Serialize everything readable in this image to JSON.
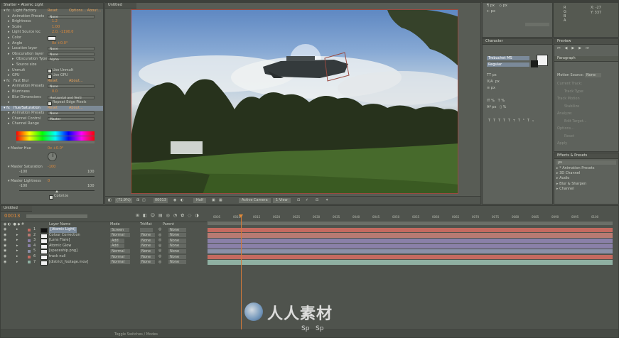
{
  "effect_controls": {
    "tab_title": "Shatter • Atomic Light",
    "rows": [
      {
        "label": "Light Factory",
        "value": "Reset",
        "extra": "Options...  About...",
        "indent": 0,
        "kind": "header"
      },
      {
        "label": "Animation Presets",
        "value": "None",
        "indent": 1,
        "kind": "dropdown"
      },
      {
        "label": "Brightness",
        "value": "1.2",
        "indent": 1,
        "kind": "value"
      },
      {
        "label": "Scale",
        "value": "1.00",
        "indent": 1,
        "kind": "value"
      },
      {
        "label": "Light Source loc",
        "value": "2.0, -1190.0",
        "indent": 1,
        "kind": "value"
      },
      {
        "label": "Color",
        "value": "",
        "indent": 1,
        "kind": "color"
      },
      {
        "label": "Angle",
        "value": "0x +0.0°",
        "indent": 1,
        "kind": "value"
      },
      {
        "label": "Location layer",
        "value": "None",
        "indent": 1,
        "kind": "dropdown"
      },
      {
        "label": "Obscuration layer",
        "value": "None",
        "indent": 1,
        "kind": "dropdown"
      },
      {
        "label": "Obscuration Type",
        "value": "Alpha",
        "indent": 2,
        "kind": "dropdown"
      },
      {
        "label": "Source size",
        "value": "",
        "indent": 2,
        "kind": "value"
      },
      {
        "label": "Unmult",
        "value": "Use Unmult",
        "indent": 1,
        "kind": "check"
      },
      {
        "label": "GPU",
        "value": "Use GPU",
        "indent": 1,
        "kind": "check"
      },
      {
        "label": "Fast Blur",
        "value": "Reset",
        "extra": "About...",
        "indent": 0,
        "kind": "header"
      },
      {
        "label": "Animation Presets",
        "value": "None",
        "indent": 1,
        "kind": "dropdown"
      },
      {
        "label": "Blurriness",
        "value": "0.0",
        "indent": 1,
        "kind": "value"
      },
      {
        "label": "Blur Dimensions",
        "value": "Horizontal and Verti",
        "indent": 1,
        "kind": "dropdown"
      },
      {
        "label": "",
        "value": "Repeat Edge Pixels",
        "indent": 1,
        "kind": "check"
      },
      {
        "label": "Hue/Saturation",
        "value": "Reset",
        "extra": "About...",
        "indent": 0,
        "kind": "header-selected"
      },
      {
        "label": "Animation Presets",
        "value": "None",
        "indent": 1,
        "kind": "dropdown"
      },
      {
        "label": "Channel Control",
        "value": "Master",
        "indent": 1,
        "kind": "dropdown"
      },
      {
        "label": "Channel Range",
        "value": "",
        "indent": 1,
        "kind": "value"
      }
    ],
    "master_hue_label": "Master Hue",
    "master_hue_value": "0x +0.0°",
    "master_saturation_label": "Master Saturation",
    "master_saturation_value": "-100",
    "sat_min": "-100",
    "sat_max": "100",
    "master_lightness_label": "Master Lightness",
    "master_lightness_value": "0",
    "light_min": "-100",
    "light_max": "100",
    "colorize_label": "Colorize"
  },
  "viewer": {
    "tab_title": "Untitled",
    "zoom": "(71.9%)",
    "timecode": "00013",
    "resolution": "Half",
    "camera": "Active Camera",
    "views": "1 View"
  },
  "tools_panel": {
    "rows": [
      "px",
      "px",
      "px"
    ],
    "info_values": [
      "X: -27",
      "Y: 337"
    ],
    "info_letters": [
      "R",
      "G",
      "B",
      "A"
    ]
  },
  "character": {
    "tab_title": "Character",
    "font": "Trebuchet MS",
    "style": "Regular",
    "size_units": [
      "px",
      "px",
      "px",
      "%",
      "%",
      "px",
      "%"
    ]
  },
  "preview": {
    "tab_title": "Preview",
    "inner_title": "Paragraph",
    "motion_source_label": "Motion Source:",
    "motion_source_value": "None",
    "faded_rows": [
      "Current Track:",
      "Track Type:",
      "Track Motion",
      "Stabilize",
      "Analyze:",
      "Edit Target...",
      "Options...",
      "Reset",
      "Apply"
    ]
  },
  "effects_presets": {
    "tab_title": "Effects & Presets",
    "search_placeholder": "ρ▾",
    "items": [
      "* Animation Presets",
      "3D Channel",
      "Audio",
      "Blur & Sharpen",
      "Channel"
    ]
  },
  "timeline": {
    "tab_title": "Untitled",
    "timecode": "00013",
    "columns": {
      "layer_name": "Layer Name",
      "mode": "Mode",
      "trkmat": "TrkMat",
      "parent": "Parent"
    },
    "layers": [
      {
        "num": "1",
        "name": "[Atomic Light]",
        "mode": "Screen",
        "trkmat": "",
        "parent": "None",
        "color": "#c46a60"
      },
      {
        "num": "2",
        "name": "Colour Correction",
        "mode": "Normal",
        "trkmat": "None",
        "parent": "None",
        "color": "#b87a72"
      },
      {
        "num": "3",
        "name": "[Lens Flare]",
        "mode": "Add",
        "trkmat": "None",
        "parent": "None",
        "color": "#8a80a8"
      },
      {
        "num": "4",
        "name": "Atomic Glow",
        "mode": "Add",
        "trkmat": "None",
        "parent": "None",
        "color": "#8a80a8"
      },
      {
        "num": "5",
        "name": "[spaceship.png]",
        "mode": "Normal",
        "trkmat": "None",
        "parent": "None",
        "color": "#8a90a8"
      },
      {
        "num": "6",
        "name": "track null",
        "mode": "Normal",
        "trkmat": "None",
        "parent": "None",
        "color": "#c46a60"
      },
      {
        "num": "7",
        "name": "[district_footage.mov]",
        "mode": "Normal",
        "trkmat": "None",
        "parent": "None",
        "color": "#8fb0a2"
      }
    ],
    "ruler_marks": [
      "0005",
      "0010",
      "0015",
      "0020",
      "0025",
      "0030",
      "0035",
      "0040",
      "0045",
      "0050",
      "0055",
      "0060",
      "0065",
      "0070",
      "0075",
      "0080",
      "0085",
      "0090",
      "0095",
      "0100"
    ],
    "footer_label": "Toggle Switches / Modes"
  },
  "watermark": {
    "text": "人人素材",
    "subtext": "Sp   Sp"
  },
  "colors": {
    "accent_orange": "#e08a3a",
    "panel_bg": "#5e625c",
    "track_red": "#c46a60",
    "track_purple": "#8a80a8",
    "track_teal": "#8fb0a2"
  }
}
